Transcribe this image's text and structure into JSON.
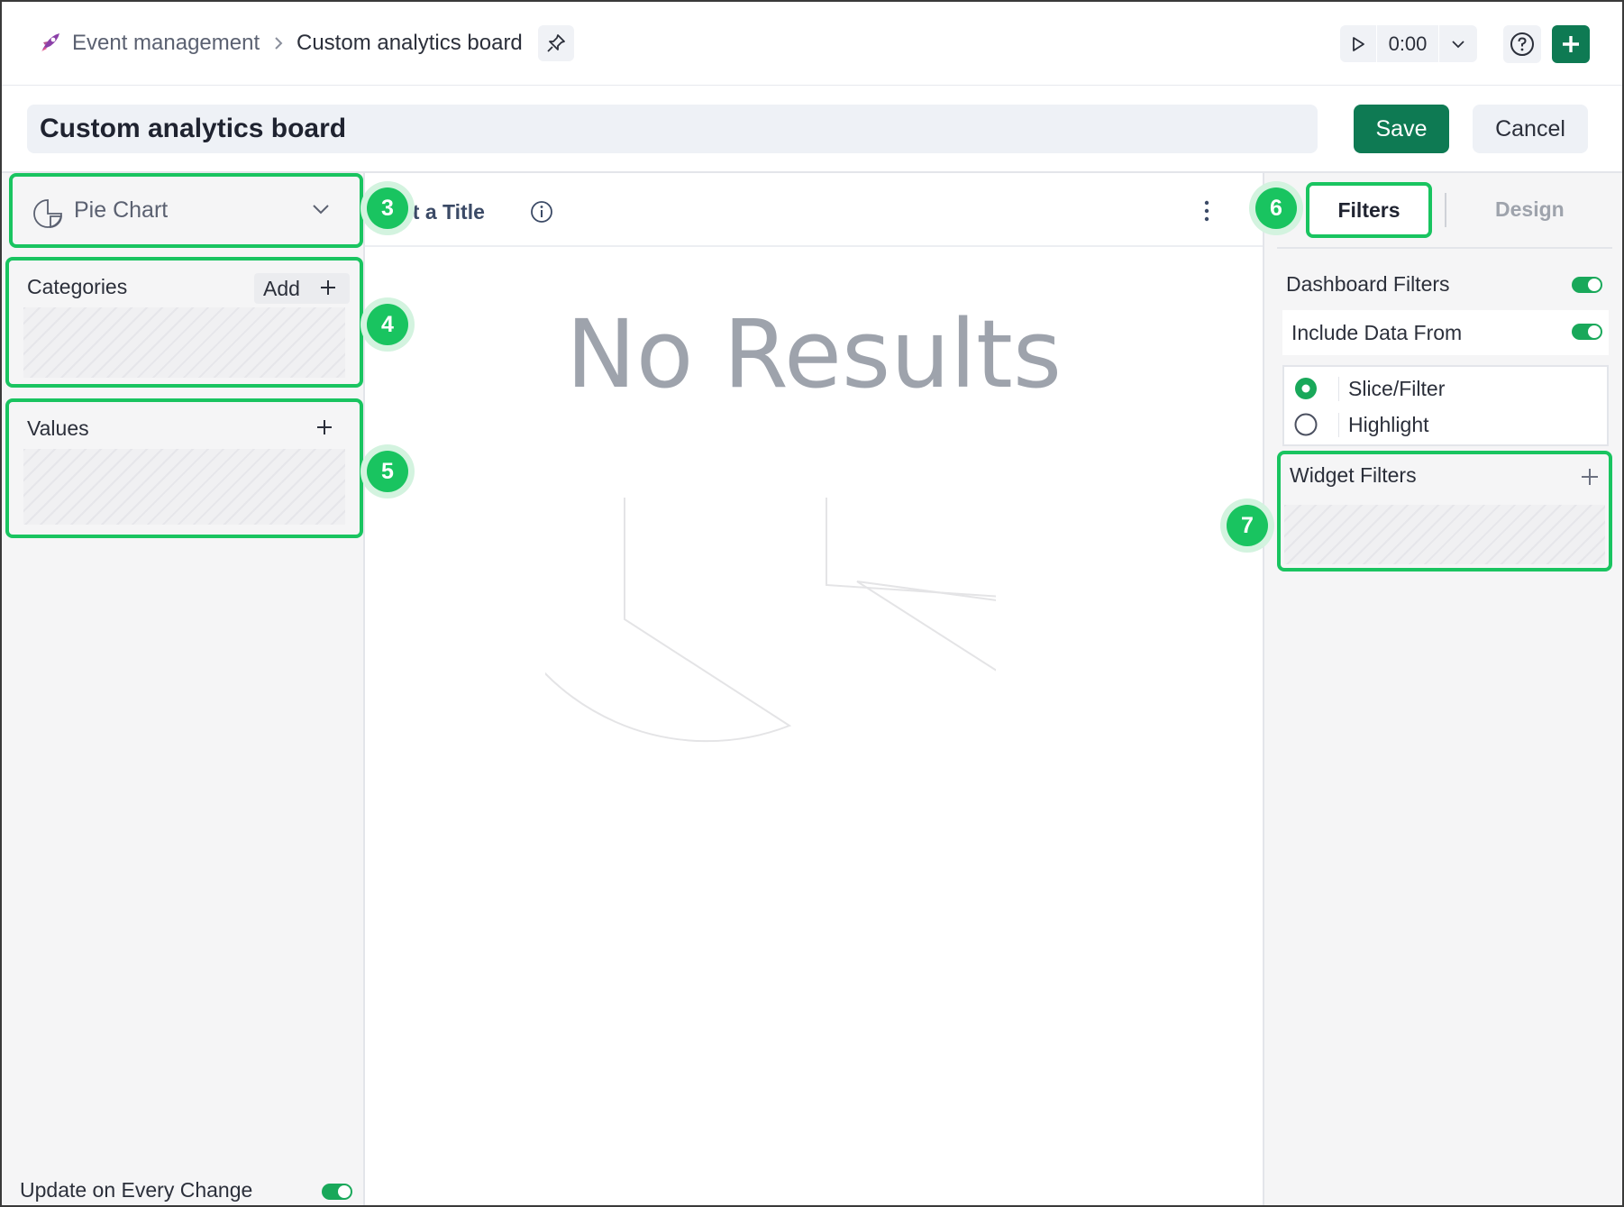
{
  "colors": {
    "accent": "#0e7a53",
    "highlight": "#19c460",
    "badge_halo": "#d3f3df"
  },
  "header": {
    "app_icon": "rocket-icon",
    "breadcrumb_root": "Event management",
    "breadcrumb_current": "Custom analytics board",
    "playback_time": "0:00"
  },
  "editor": {
    "title_value": "Custom analytics board",
    "save_label": "Save",
    "cancel_label": "Cancel"
  },
  "left_panel": {
    "chart_type": "Pie Chart",
    "categories_label": "Categories",
    "categories_add_label": "Add",
    "values_label": "Values",
    "update_label": "Update on Every Change",
    "update_on": true
  },
  "badges": [
    "3",
    "4",
    "5",
    "6",
    "7"
  ],
  "center": {
    "widget_title": "et a Title",
    "empty_message": "No Results"
  },
  "right_panel": {
    "tabs": [
      "Filters",
      "Design"
    ],
    "active_tab": "Filters",
    "dashboard_filters_label": "Dashboard Filters",
    "dashboard_filters_on": true,
    "include_data_label": "Include Data From",
    "include_data_on": true,
    "options": [
      {
        "label": "Slice/Filter",
        "selected": true
      },
      {
        "label": "Highlight",
        "selected": false
      }
    ],
    "widget_filters_label": "Widget Filters"
  }
}
